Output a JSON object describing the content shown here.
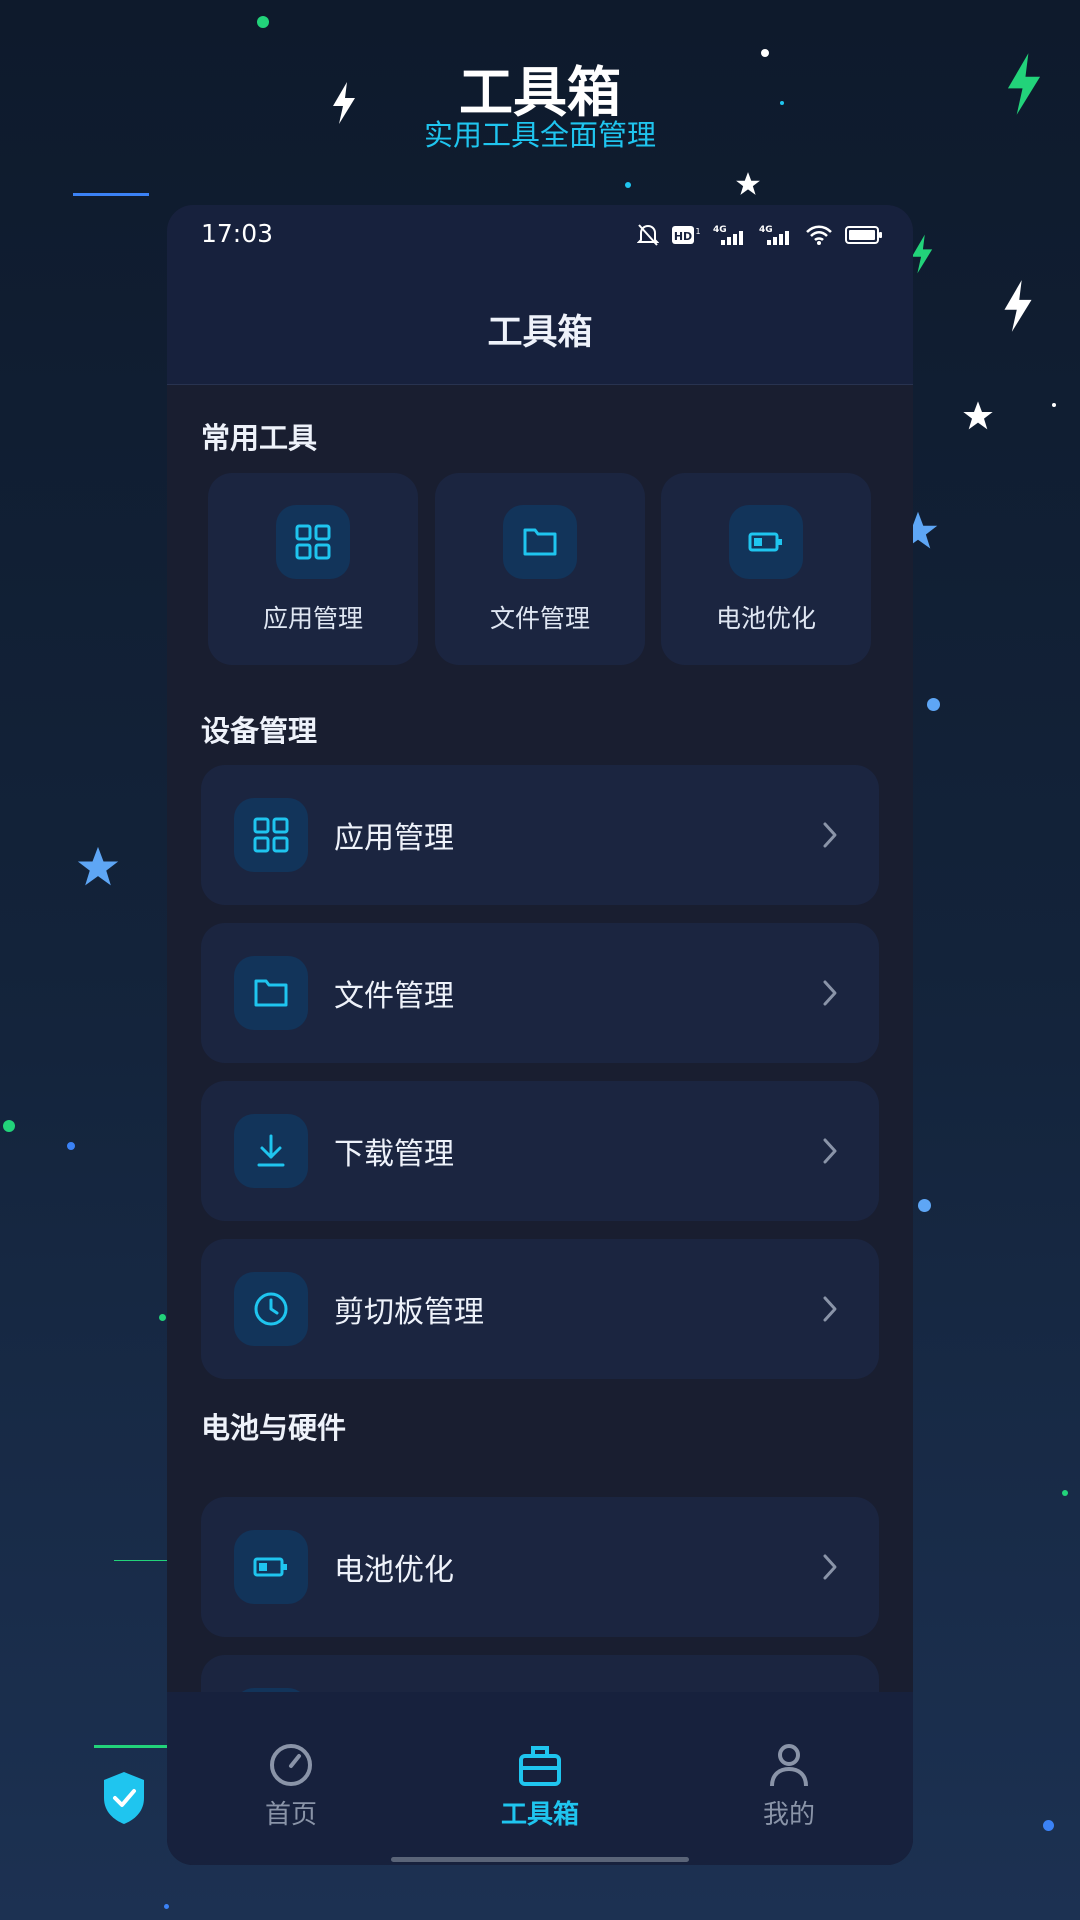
{
  "header": {
    "title": "工具箱",
    "subtitle": "实用工具全面管理"
  },
  "status_bar": {
    "time": "17:03"
  },
  "app_bar": {
    "title": "工具箱"
  },
  "common_tools": {
    "title": "常用工具",
    "items": [
      {
        "label": "应用管理",
        "icon": "grid-icon"
      },
      {
        "label": "文件管理",
        "icon": "folder-icon"
      },
      {
        "label": "电池优化",
        "icon": "battery-icon"
      }
    ]
  },
  "device_management": {
    "title": "设备管理",
    "items": [
      {
        "label": "应用管理",
        "icon": "grid-icon"
      },
      {
        "label": "文件管理",
        "icon": "folder-icon"
      },
      {
        "label": "下载管理",
        "icon": "download-icon"
      },
      {
        "label": "剪切板管理",
        "icon": "clock-icon"
      }
    ]
  },
  "battery_hardware": {
    "title": "电池与硬件",
    "items": [
      {
        "label": "电池优化",
        "icon": "battery-icon"
      }
    ]
  },
  "bottom_nav": {
    "items": [
      {
        "label": "首页",
        "icon": "gauge-icon",
        "active": false
      },
      {
        "label": "工具箱",
        "icon": "toolbox-icon",
        "active": true
      },
      {
        "label": "我的",
        "icon": "person-icon",
        "active": false
      }
    ]
  },
  "colors": {
    "accent": "#1fc5ef",
    "card": "#1b2540",
    "background": "#191e30",
    "inactive": "#8a94a8"
  }
}
